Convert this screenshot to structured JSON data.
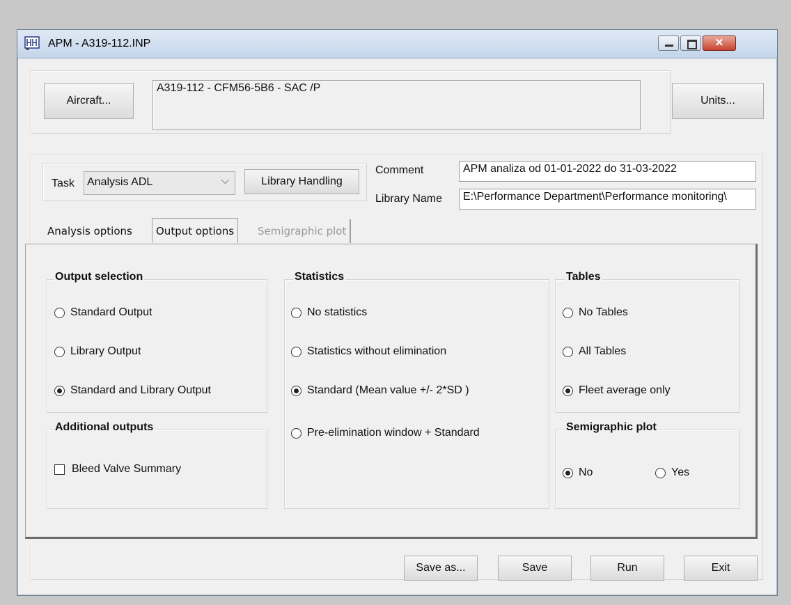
{
  "window": {
    "title": "APM - A319-112.INP"
  },
  "aircraft": {
    "button_label": "Aircraft...",
    "info": "A319-112 - CFM56-5B6 -  SAC /P"
  },
  "units": {
    "button_label": "Units..."
  },
  "task": {
    "label": "Task",
    "selected": "Analysis ADL",
    "library_button": "Library Handling"
  },
  "comment": {
    "label": "Comment",
    "value": "APM analiza od 01-01-2022 do 31-03-2022"
  },
  "library_name": {
    "label": "Library Name",
    "value": "E:\\Performance Department\\Performance monitoring\\"
  },
  "tabs": [
    {
      "label": "Analysis options"
    },
    {
      "label": "Output options"
    },
    {
      "label": "Semigraphic plot"
    }
  ],
  "output_selection": {
    "title": "Output selection",
    "options": [
      {
        "label": "Standard Output",
        "checked": false
      },
      {
        "label": "Library Output",
        "checked": false
      },
      {
        "label": "Standard and Library Output",
        "checked": true
      }
    ]
  },
  "additional_outputs": {
    "title": "Additional outputs",
    "bleed_valve_label": "Bleed Valve Summary",
    "bleed_valve_checked": false
  },
  "statistics": {
    "title": "Statistics",
    "options": [
      {
        "label": "No statistics",
        "checked": false
      },
      {
        "label": "Statistics without elimination",
        "checked": false
      },
      {
        "label": "Standard (Mean value +/- 2*SD )",
        "checked": true
      },
      {
        "label": "Pre-elimination window + Standard",
        "checked": false
      }
    ]
  },
  "tables": {
    "title": "Tables",
    "options": [
      {
        "label": "No Tables",
        "checked": false
      },
      {
        "label": "All Tables",
        "checked": false
      },
      {
        "label": "Fleet average only",
        "checked": true
      }
    ]
  },
  "semigraphic_plot": {
    "title": "Semigraphic plot",
    "options": [
      {
        "label": "No",
        "checked": true
      },
      {
        "label": "Yes",
        "checked": false
      }
    ]
  },
  "footer": {
    "save_as": "Save as...",
    "save": "Save",
    "run": "Run",
    "exit": "Exit"
  }
}
